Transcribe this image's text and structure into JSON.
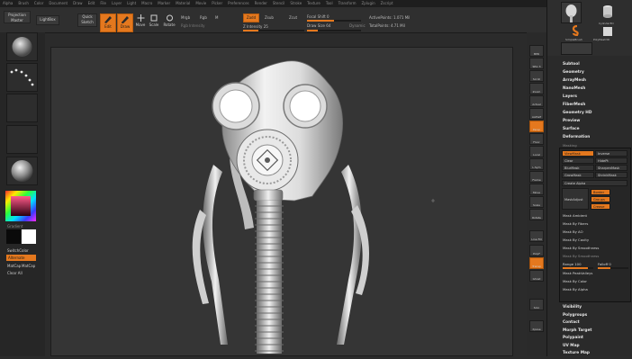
{
  "menubar": [
    "Alpha",
    "Brush",
    "Color",
    "Document",
    "Draw",
    "Edit",
    "File",
    "Layer",
    "Light",
    "Macro",
    "Marker",
    "Material",
    "Movie",
    "Picker",
    "Preferences",
    "Render",
    "Stencil",
    "Stroke",
    "Texture",
    "Tool",
    "Transform",
    "Zplugin",
    "Zscript"
  ],
  "topshelf": {
    "projection_master": "Projection Master",
    "lightbox": "LightBox",
    "quick_sketch": "Quick Sketch",
    "edit": "Edit",
    "draw": "Draw",
    "move": "Move",
    "scale": "Scale",
    "rotate": "Rotate",
    "mrgb": "Mrgb",
    "rgb": "Rgb",
    "m": "M",
    "rgb_intensity": "Rgb Intensity",
    "zadd": "Zadd",
    "zsub": "Zsub",
    "zcut": "Zcut",
    "z_intensity": "Z Intensity 25",
    "focal_shift": "Focal Shift 0",
    "draw_size": "Draw Size 64",
    "dynamic": "Dynamic",
    "active_points": "ActivePoints: 1.071 Mil",
    "total_points": "TotalPoints: 4.71 Mil"
  },
  "leftshelf": {
    "alternate": "Alternate",
    "gradient": "Gradient",
    "switch_color": "SwitchColor",
    "texture_off": "Texture Off",
    "matcap": "MatCap",
    "matcap2": "MatCap",
    "clear_all": "Clear All",
    "swatch_main": "#0a0a0a",
    "swatch_secondary": "#ffffff"
  },
  "rightshelf": [
    "BPR",
    "SPix 3",
    "Scroll",
    "Zoom",
    "Actual",
    "AAHalf",
    "Persp",
    "Floor",
    "Local",
    "L.Sym",
    "Frame",
    "Move",
    "Scale",
    "Rotate",
    "Line Fill",
    "PolyF",
    "Transp",
    "Ghost",
    "Solo",
    "Xpose"
  ],
  "tray": {
    "top_items": [
      "Gas Mask",
      "Cylinder3D",
      "SimpleBrush",
      "PolyMesh3D"
    ],
    "menu": [
      "Subtool",
      "Geometry",
      "ArrayMesh",
      "NanoMesh",
      "Layers",
      "FiberMesh",
      "Geometry HD",
      "Preview",
      "Surface",
      "Deformation",
      "Masking"
    ],
    "masking": {
      "view_mask": "ViewMask",
      "inverse": "Inverse",
      "clear": "Clear",
      "hide_pt": "HidePt",
      "blur_mask": "BlurMask",
      "sharpen_mask": "SharpenMask",
      "grow_mask": "GrowMask",
      "shrink_mask": "ShrinkMask",
      "create_alpha": "Create Alpha",
      "mask_adjust": "MaskAdjust",
      "border": "Border",
      "groups": "Groups",
      "crease": "Crease",
      "items": [
        "Mask Ambient",
        "Mask By Fibers",
        "Mask By AO",
        "Mask By Cavity",
        "Mask By Smoothness",
        "Mask By Smoothness",
        "Range 100",
        "Falloff 0",
        "Mask PeakValleys",
        "Mask By Color",
        "Mask By Alpha"
      ],
      "range": "Range 100",
      "falloff": "Falloff 0"
    },
    "menu_bottom": [
      "Visibility",
      "Polygroups",
      "Contact",
      "Morph Target",
      "Polypaint",
      "UV Map",
      "Texture Map"
    ]
  },
  "colors": {
    "accent": "#e4781e"
  }
}
